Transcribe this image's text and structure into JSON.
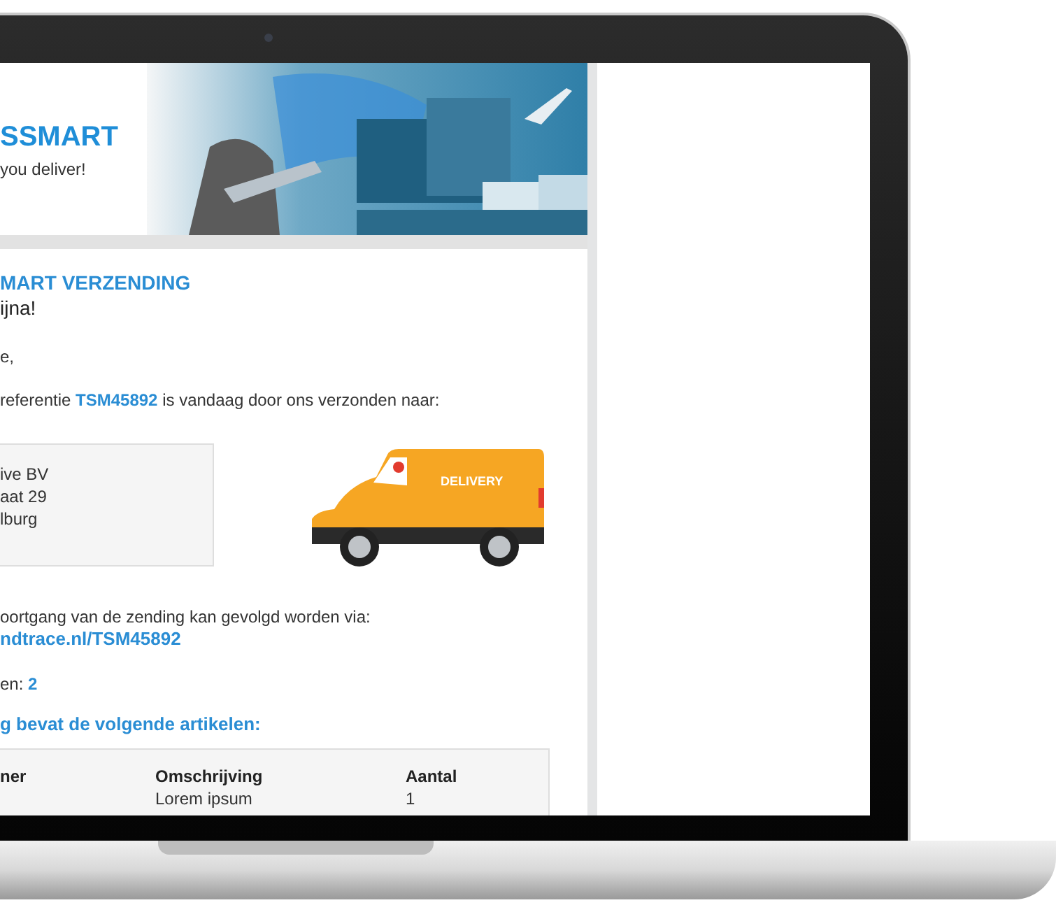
{
  "email": {
    "logo": "SSMART",
    "tagline": "you deliver!",
    "title": "MART VERZENDING",
    "subtitle": "ijna!",
    "greeting": "e,",
    "intro": "referentie **TSM45892** is vandaag door ons verzonden naar:",
    "address": [
      "ive BV",
      "aat 29",
      "lburg"
    ],
    "van_label": "DELIVERY",
    "tracking_text": "oortgang van de zending kan gevolgd worden via:",
    "tracking_link": "ndtrace.nl/TSM45892",
    "packages": "en: **2**",
    "items_heading": "g bevat de volgende artikelen:",
    "table": {
      "columns": [
        "ner",
        "Omschrijving",
        "Aantal"
      ],
      "rows": [
        {
          "description": "Lorem ipsum",
          "quantity": "1"
        }
      ]
    }
  }
}
